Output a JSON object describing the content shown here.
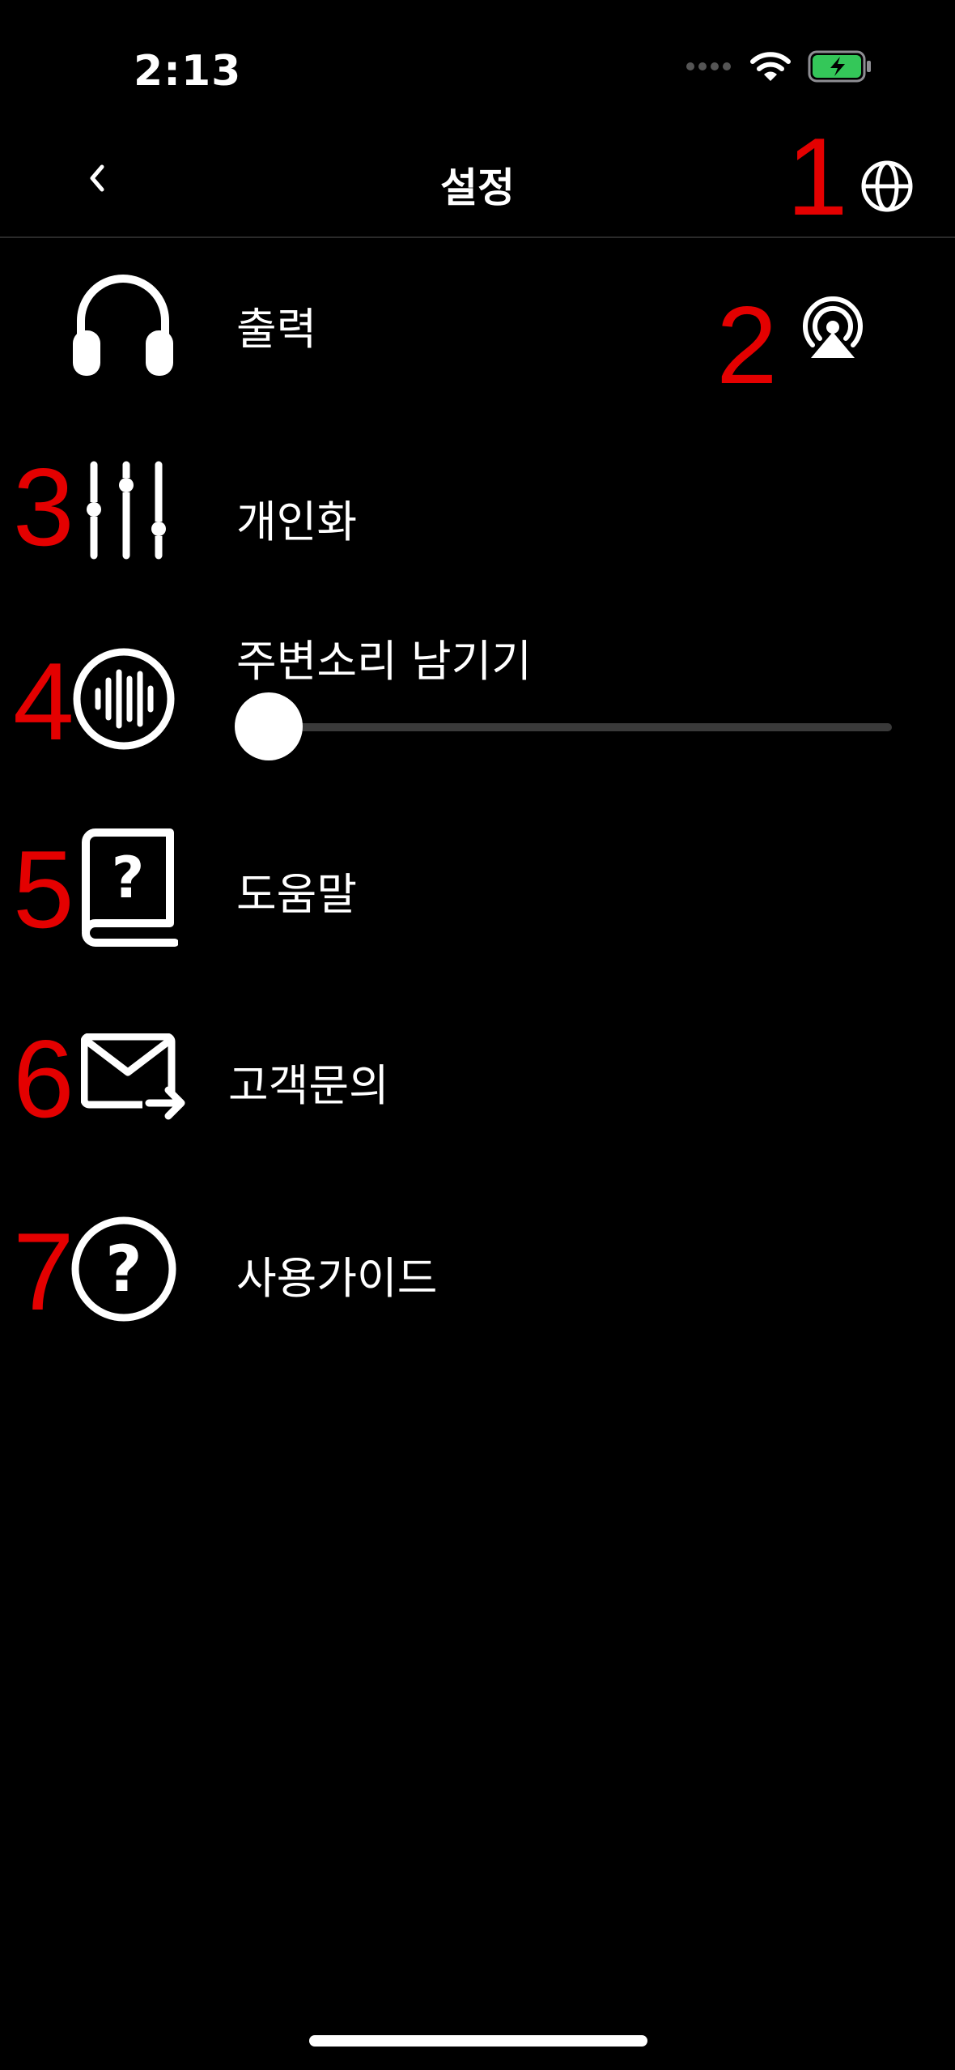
{
  "status_bar": {
    "time": "2:13",
    "icons": [
      "signal-dots-icon",
      "wifi-icon",
      "battery-charging-icon"
    ],
    "battery_color": "#34c759"
  },
  "nav": {
    "title": "설정",
    "back_icon": "chevron-left-icon",
    "language_icon": "globe-icon"
  },
  "annotations": [
    "1",
    "2",
    "3",
    "4",
    "5",
    "6",
    "7"
  ],
  "annotation_color": "#e40000",
  "menu": {
    "output": {
      "label": "출력",
      "icon": "headphones-icon",
      "action_icon": "airplay-audio-icon"
    },
    "personalize": {
      "label": "개인화",
      "icon": "equalizer-sliders-icon"
    },
    "ambient": {
      "label": "주변소리 남기기",
      "icon": "sound-wave-circle-icon",
      "slider_value": 0
    },
    "help": {
      "label": "도움말",
      "icon": "help-book-icon"
    },
    "contact": {
      "label": "고객문의",
      "icon": "mail-forward-icon"
    },
    "guide": {
      "label": "사용가이드",
      "icon": "question-circle-icon"
    }
  }
}
